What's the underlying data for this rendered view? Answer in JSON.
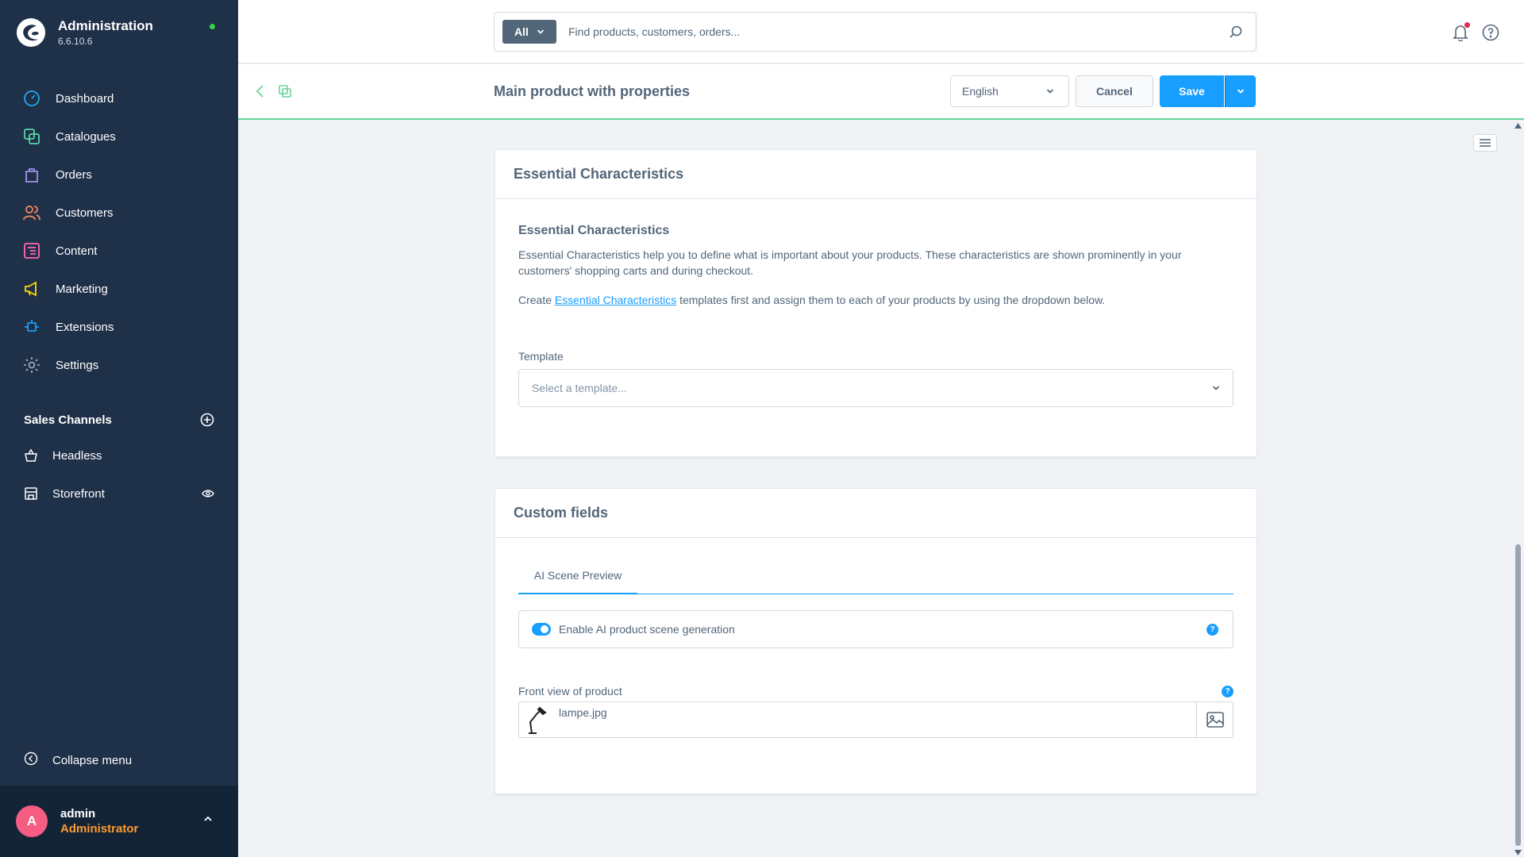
{
  "sidebar": {
    "brand_title": "Administration",
    "brand_version": "6.6.10.6",
    "status_color": "#37d046",
    "items": [
      {
        "label": "Dashboard",
        "icon": "dashboard-icon",
        "color": "#26a6e8"
      },
      {
        "label": "Catalogues",
        "icon": "catalogues-icon",
        "color": "#57d9a3"
      },
      {
        "label": "Orders",
        "icon": "orders-icon",
        "color": "#a092f0"
      },
      {
        "label": "Customers",
        "icon": "customers-icon",
        "color": "#f88962"
      },
      {
        "label": "Content",
        "icon": "content-icon",
        "color": "#ff68b4"
      },
      {
        "label": "Marketing",
        "icon": "marketing-icon",
        "color": "#ffd700"
      },
      {
        "label": "Extensions",
        "icon": "extensions-icon",
        "color": "#189eff"
      },
      {
        "label": "Settings",
        "icon": "settings-icon",
        "color": "#9aa8b5"
      }
    ],
    "sales_channels_title": "Sales Channels",
    "sales_channels": [
      {
        "label": "Headless",
        "icon": "basket-icon"
      },
      {
        "label": "Storefront",
        "icon": "storefront-icon"
      }
    ],
    "collapse_label": "Collapse menu",
    "user": {
      "initial": "A",
      "name": "admin",
      "role": "Administrator"
    }
  },
  "topbar": {
    "search_type": "All",
    "search_placeholder": "Find products, customers, orders..."
  },
  "smartbar": {
    "title": "Main product with properties",
    "language": "English",
    "cancel_label": "Cancel",
    "save_label": "Save"
  },
  "essential": {
    "card_title": "Essential Characteristics",
    "heading": "Essential Characteristics",
    "description": "Essential Characteristics help you to define what is important about your products. These characteristics are shown prominently in your customers' shopping carts and during checkout.",
    "create_prefix": "Create ",
    "create_link": "Essential Characteristics",
    "create_suffix": " templates first and assign them to each of your products by using the dropdown below.",
    "template_label": "Template",
    "template_placeholder": "Select a template..."
  },
  "custom_fields": {
    "card_title": "Custom fields",
    "tab_label": "AI Scene Preview",
    "toggle_label": "Enable AI product scene generation",
    "toggle_on": true,
    "front_view_label": "Front view of product",
    "file_name": "lampe.jpg"
  },
  "colors": {
    "sidebar_bg": "#1f3049",
    "accent": "#189eff",
    "role": "#ff9a2e",
    "avatar": "#f55d82",
    "smartbar_border": "#68d49a"
  }
}
